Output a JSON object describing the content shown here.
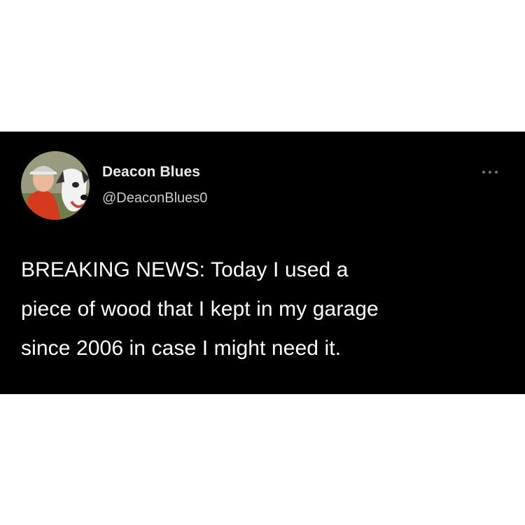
{
  "tweet": {
    "author": {
      "display_name": "Deacon Blues",
      "handle": "@DeaconBlues0",
      "avatar_icon": "user-avatar-with-dog"
    },
    "more_icon": "more-horizontal-icon",
    "text_lines": [
      "BREAKING NEWS: Today I used a",
      "piece of wood that I kept in my garage",
      "since 2006 in case I might need it."
    ]
  },
  "colors": {
    "background": "#ffffff",
    "card": "#000000",
    "primary_text": "#ffffff",
    "secondary_text": "#c9cdd1"
  }
}
